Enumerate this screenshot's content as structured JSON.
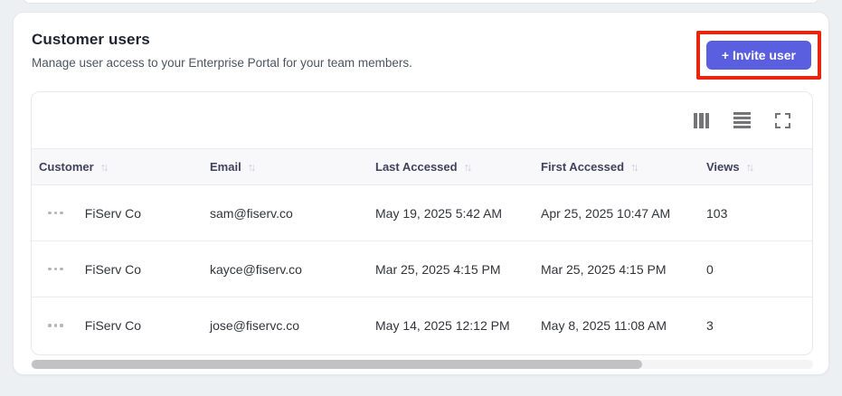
{
  "page": {
    "title": "Customer users",
    "subtitle": "Manage user access to your Enterprise Portal for your team members.",
    "invite_button_label": "+ Invite user"
  },
  "toolbar": {
    "icons": [
      "columns-icon",
      "row-density-icon",
      "fullscreen-icon"
    ]
  },
  "table": {
    "sort_glyph": "↑↓",
    "columns": [
      {
        "label": "Customer"
      },
      {
        "label": "Email"
      },
      {
        "label": "Last Accessed"
      },
      {
        "label": "First Accessed"
      },
      {
        "label": "Views"
      }
    ],
    "rows": [
      {
        "customer": "FiServ Co",
        "email": "sam@fiserv.co",
        "last_accessed": "May 19, 2025 5:42 AM",
        "first_accessed": "Apr 25, 2025 10:47 AM",
        "views": "103"
      },
      {
        "customer": "FiServ Co",
        "email": "kayce@fiserv.co",
        "last_accessed": "Mar 25, 2025 4:15 PM",
        "first_accessed": "Mar 25, 2025 4:15 PM",
        "views": "0"
      },
      {
        "customer": "FiServ Co",
        "email": "jose@fiservc.co",
        "last_accessed": "May 14, 2025 12:12 PM",
        "first_accessed": "May 8, 2025 11:08 AM",
        "views": "3"
      }
    ]
  },
  "scrollbar": {
    "thumb_percent": 78
  },
  "colors": {
    "accent": "#5a5fe0",
    "annotation_highlight": "#e8250d",
    "header_background": "#f8f8fb",
    "page_background": "#edf0f2"
  }
}
